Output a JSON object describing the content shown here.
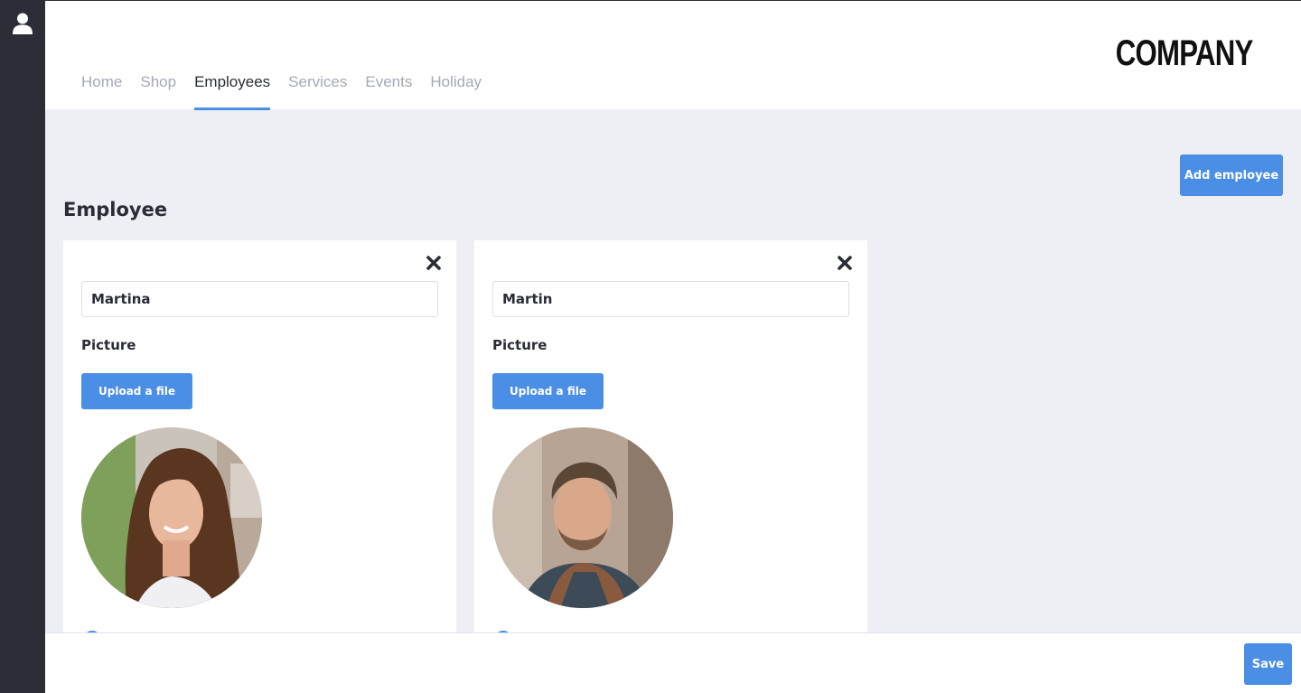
{
  "sidebar": {
    "icon": "user-icon"
  },
  "header": {
    "logo": "COMPANY",
    "tabs": [
      {
        "label": "Home",
        "active": false
      },
      {
        "label": "Shop",
        "active": false
      },
      {
        "label": "Employees",
        "active": true
      },
      {
        "label": "Services",
        "active": false
      },
      {
        "label": "Events",
        "active": false
      },
      {
        "label": "Holiday",
        "active": false
      }
    ]
  },
  "main": {
    "add_button": "Add employee",
    "section_title": "Employee",
    "employees": [
      {
        "name": "Martina",
        "picture_label": "Picture",
        "upload_label": "Upload a file",
        "photo": "woman-portrait-photo"
      },
      {
        "name": "Martin",
        "picture_label": "Picture",
        "upload_label": "Upload a file",
        "photo": "man-portrait-photo"
      }
    ]
  },
  "footer": {
    "save_label": "Save"
  },
  "colors": {
    "accent": "#4a8ee6",
    "sidebar": "#2b2e36",
    "background": "#edeff4"
  }
}
